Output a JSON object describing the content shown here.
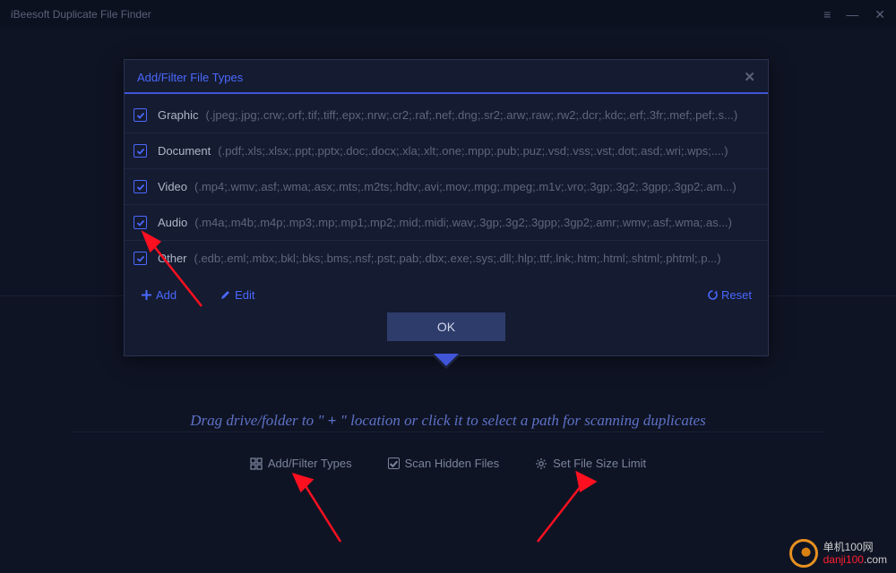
{
  "titlebar": {
    "title": "iBeesoft Duplicate File Finder"
  },
  "dialog": {
    "title": "Add/Filter File Types",
    "types": [
      {
        "name": "Graphic",
        "exts": "(.jpeg;.jpg;.crw;.orf;.tif;.tiff;.epx;.nrw;.cr2;.raf;.nef;.dng;.sr2;.arw;.raw;.rw2;.dcr;.kdc;.erf;.3fr;.mef;.pef;.s...)"
      },
      {
        "name": "Document",
        "exts": "(.pdf;.xls;.xlsx;.ppt;.pptx;.doc;.docx;.xla;.xlt;.one;.mpp;.pub;.puz;.vsd;.vss;.vst;.dot;.asd;.wri;.wps;....)"
      },
      {
        "name": "Video",
        "exts": "(.mp4;.wmv;.asf;.wma;.asx;.mts;.m2ts;.hdtv;.avi;.mov;.mpg;.mpeg;.m1v;.vro;.3gp;.3g2;.3gpp;.3gp2;.am...)"
      },
      {
        "name": "Audio",
        "exts": "(.m4a;.m4b;.m4p;.mp3;.mp;.mp1;.mp2;.mid;.midi;.wav;.3gp;.3g2;.3gpp;.3gp2;.amr;.wmv;.asf;.wma;.as...)"
      },
      {
        "name": "Other",
        "exts": "(.edb;.eml;.mbx;.bkl;.bks;.bms;.nsf;.pst;.pab;.dbx;.exe;.sys;.dll;.hlp;.ttf;.lnk;.htm;.html;.shtml;.phtml;.p...)"
      }
    ],
    "add_label": "Add",
    "edit_label": "Edit",
    "reset_label": "Reset",
    "ok_label": "OK"
  },
  "drag_hint": {
    "before": "Drag drive/folder to \" ",
    "plus": "+",
    "after": " \" location or click it to select a path for scanning duplicates"
  },
  "options": {
    "filter_types": "Add/Filter Types",
    "scan_hidden": "Scan Hidden Files",
    "size_limit": "Set File Size Limit"
  },
  "watermark": {
    "line1": "单机100网",
    "domain": "danji100",
    "suffix": ".com"
  }
}
